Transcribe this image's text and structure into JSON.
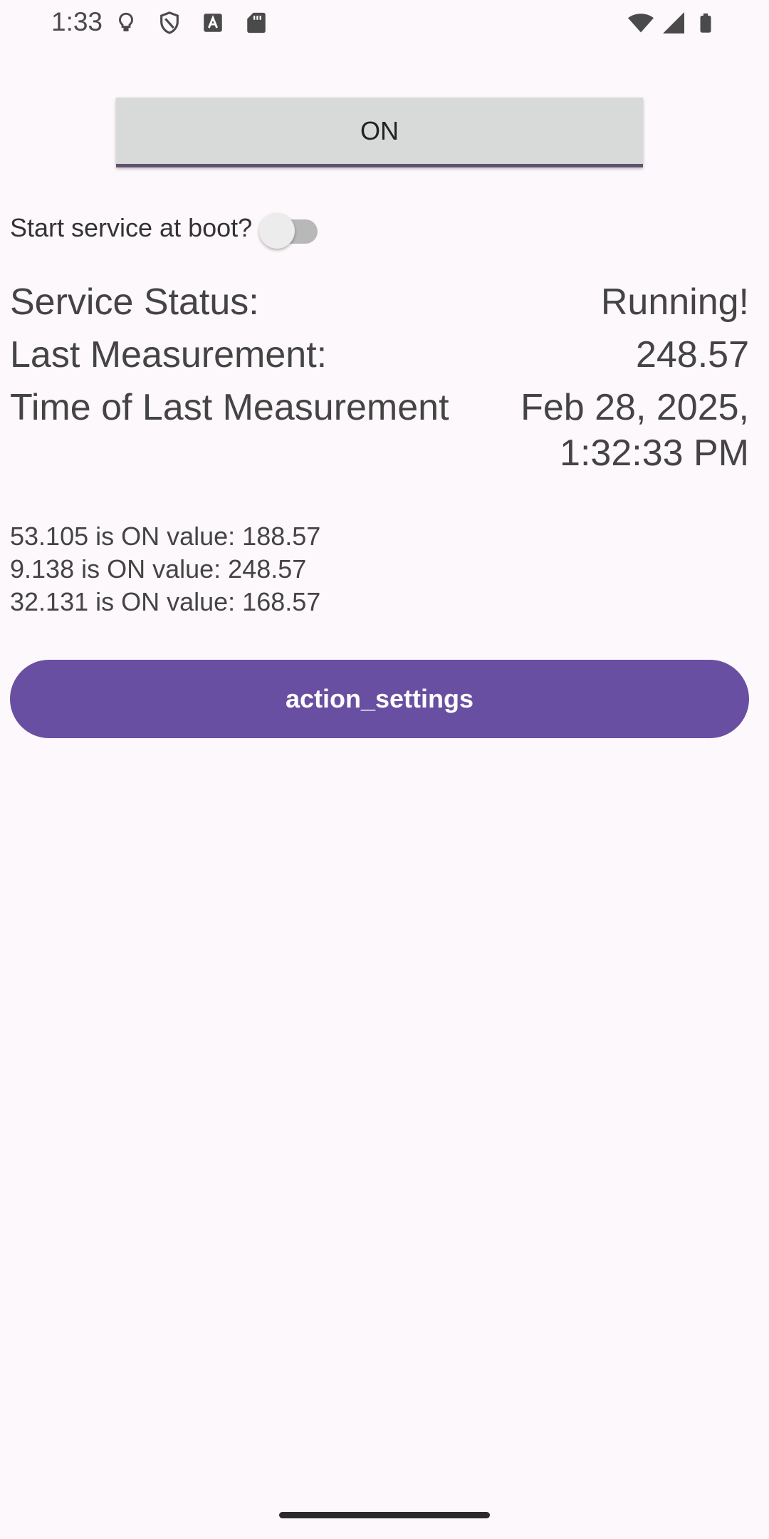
{
  "status_bar": {
    "time": "1:33",
    "left_icons": [
      "lightbulb-icon",
      "shield-icon",
      "font-icon",
      "sd-card-icon"
    ],
    "right_icons": [
      "wifi-icon",
      "cellular-signal-icon",
      "battery-icon"
    ]
  },
  "toggle_button": {
    "label": "ON"
  },
  "boot_setting": {
    "label": "Start service at boot?",
    "enabled": false
  },
  "service_info": {
    "status_label": "Service Status:",
    "status_value": "Running!",
    "last_measurement_label": "Last Measurement:",
    "last_measurement_value": "248.57",
    "time_label": "Time of Last Measurement",
    "time_value_line1": "Feb 28, 2025,",
    "time_value_line2": "1:32:33 PM"
  },
  "log": [
    "53.105 is ON value: 188.57",
    "9.138 is ON value: 248.57",
    "32.131 is ON value: 168.57"
  ],
  "settings_button": {
    "label": "action_settings"
  },
  "colors": {
    "accent": "#684fa1",
    "background": "#fdf8fb",
    "button_gray": "#d8d9d9"
  }
}
